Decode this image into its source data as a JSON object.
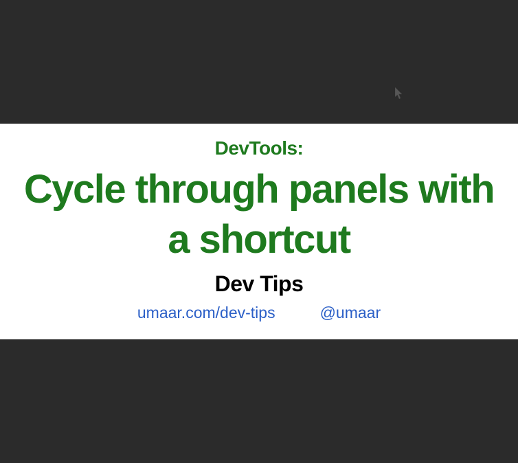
{
  "slide": {
    "category": "DevTools:",
    "title": "Cycle through panels with a shortcut",
    "series": "Dev Tips",
    "links": {
      "website": "umaar.com/dev-tips",
      "twitter": "@umaar"
    }
  }
}
